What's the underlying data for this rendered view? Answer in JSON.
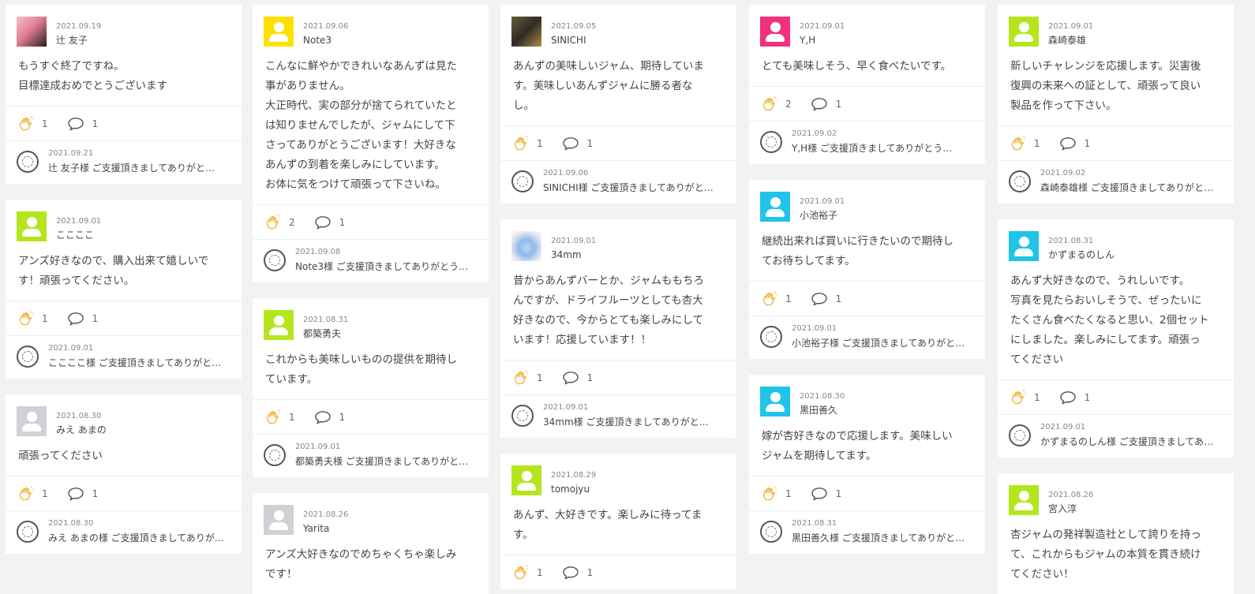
{
  "colors": {
    "avatar_lime": "#b5e61d",
    "avatar_yellow": "#ffe000",
    "avatar_pink": "#f0327a",
    "avatar_cyan": "#20c4e8",
    "avatar_gray": "#d0d0d6",
    "clap_accent": "#f2b233"
  },
  "columns": [
    {
      "cards": [
        {
          "avatar": "photo-person",
          "date": "2021.09.19",
          "name": "辻 友子",
          "text": "もうすぐ終了ですね。\n目標達成おめでとうございます",
          "likes": "1",
          "comments": "1",
          "reply_date": "2021.09.21",
          "reply_text": "辻 友子様 ご支援頂きましてありがと…"
        },
        {
          "avatar": "default",
          "avatar_color": "#b5e61d",
          "date": "2021.09.01",
          "name": "ここここ",
          "text": "アンズ好きなので、購入出来て嬉しいで\nす！頑張ってください。",
          "likes": "1",
          "comments": "1",
          "reply_date": "2021.09.01",
          "reply_text": "ここここ様 ご支援頂きましてありがと…"
        },
        {
          "avatar": "default",
          "avatar_color": "#d0d0d6",
          "date": "2021.08.30",
          "name": "みえ あまの",
          "text": "頑張ってください",
          "likes": "1",
          "comments": "1",
          "reply_date": "2021.08.30",
          "reply_text": "みえ あまの様 ご支援頂きましてありが…"
        }
      ]
    },
    {
      "cards": [
        {
          "avatar": "default",
          "avatar_color": "#ffe000",
          "date": "2021.09.06",
          "name": "Note3",
          "text": "こんなに鮮やかできれいなあんずは見た\n事がありません。\n大正時代、実の部分が捨てられていたと\nは知りませんでしたが、ジャムにして下\nさってありがとうございます！大好きな\nあんずの到着を楽しみにしています。\nお体に気をつけて頑張って下さいね。",
          "likes": "2",
          "comments": "1",
          "reply_date": "2021.09.08",
          "reply_text": "Note3様 ご支援頂きましてありがとう…"
        },
        {
          "avatar": "default",
          "avatar_color": "#b5e61d",
          "date": "2021.08.31",
          "name": "都築勇夫",
          "text": "これからも美味しいものの提供を期待し\nています。",
          "likes": "1",
          "comments": "1",
          "reply_date": "2021.09.01",
          "reply_text": "都築勇夫様 ご支援頂きましてありがと…"
        },
        {
          "avatar": "default",
          "avatar_color": "#d0d0d6",
          "date": "2021.08.26",
          "name": "Yarita",
          "text": "アンズ大好きなのでめちゃくちゃ楽しみ\nです！",
          "likes": "",
          "comments": "",
          "reply_date": "",
          "reply_text": ""
        }
      ]
    },
    {
      "cards": [
        {
          "avatar": "photo-dark",
          "date": "2021.09.05",
          "name": "SINICHI",
          "text": "あんずの美味しいジャム、期待していま\nす。美味しいあんずジャムに勝る者な\nし。",
          "likes": "1",
          "comments": "1",
          "reply_date": "2021.09.06",
          "reply_text": "SINICHI様 ご支援頂きましてありがと…"
        },
        {
          "avatar": "photo-glass",
          "date": "2021.09.01",
          "name": "34mm",
          "text": "昔からあんずバーとか、ジャムももちろ\nんですが、ドライフルーツとしても杏大\n好きなので、今からとても楽しみにして\nいます！応援しています！！",
          "likes": "1",
          "comments": "1",
          "reply_date": "2021.09.01",
          "reply_text": "34mm様 ご支援頂きましてありがと…"
        },
        {
          "avatar": "default",
          "avatar_color": "#b5e61d",
          "date": "2021.08.29",
          "name": "tomojyu",
          "text": "あんず、大好きです。楽しみに待ってま\nす。",
          "likes": "1",
          "comments": "1",
          "reply_date": "",
          "reply_text": ""
        }
      ]
    },
    {
      "cards": [
        {
          "avatar": "default",
          "avatar_color": "#f0327a",
          "date": "2021.09.01",
          "name": "Y,H",
          "text": "とても美味しそう、早く食べたいです。",
          "likes": "2",
          "comments": "1",
          "reply_date": "2021.09.02",
          "reply_text": "Y,H様 ご支援頂きましてありがとう…"
        },
        {
          "avatar": "default",
          "avatar_color": "#20c4e8",
          "date": "2021.09.01",
          "name": "小池裕子",
          "text": "継続出来れば買いに行きたいので期待し\nてお待ちしてます。",
          "likes": "1",
          "comments": "1",
          "reply_date": "2021.09.01",
          "reply_text": "小池裕子様 ご支援頂きましてありがと…"
        },
        {
          "avatar": "default",
          "avatar_color": "#20c4e8",
          "date": "2021.08.30",
          "name": "黒田善久",
          "text": "嫁が杏好きなので応援します。美味しい\nジャムを期待してます。",
          "likes": "1",
          "comments": "1",
          "reply_date": "2021.08.31",
          "reply_text": "黒田善久様 ご支援頂きましてありがと…"
        }
      ]
    },
    {
      "cards": [
        {
          "avatar": "default",
          "avatar_color": "#b5e61d",
          "date": "2021.09.01",
          "name": "森崎泰雄",
          "text": "新しいチャレンジを応援します。災害後\n復興の未来への証として、頑張って良い\n製品を作って下さい。",
          "likes": "1",
          "comments": "1",
          "reply_date": "2021.09.02",
          "reply_text": "森崎泰雄様 ご支援頂きましてありがと…"
        },
        {
          "avatar": "default",
          "avatar_color": "#20c4e8",
          "date": "2021.08.31",
          "name": "かずまるのしん",
          "text": "あんず大好きなので、うれしいです。\n写真を見たらおいしそうで、ぜったいに\nたくさん食べたくなると思い、2個セット\nにしました。楽しみにしてます。頑張っ\nてください",
          "likes": "1",
          "comments": "1",
          "reply_date": "2021.09.01",
          "reply_text": "かずまるのしん様 ご支援頂きましてあ…"
        },
        {
          "avatar": "default",
          "avatar_color": "#b5e61d",
          "date": "2021.08.26",
          "name": "宮入淳",
          "text": "杏ジャムの発祥製造社として誇りを持っ\nて、これからもジャムの本質を貫き続け\nてください！",
          "likes": "",
          "comments": "",
          "reply_date": "",
          "reply_text": ""
        }
      ]
    }
  ]
}
